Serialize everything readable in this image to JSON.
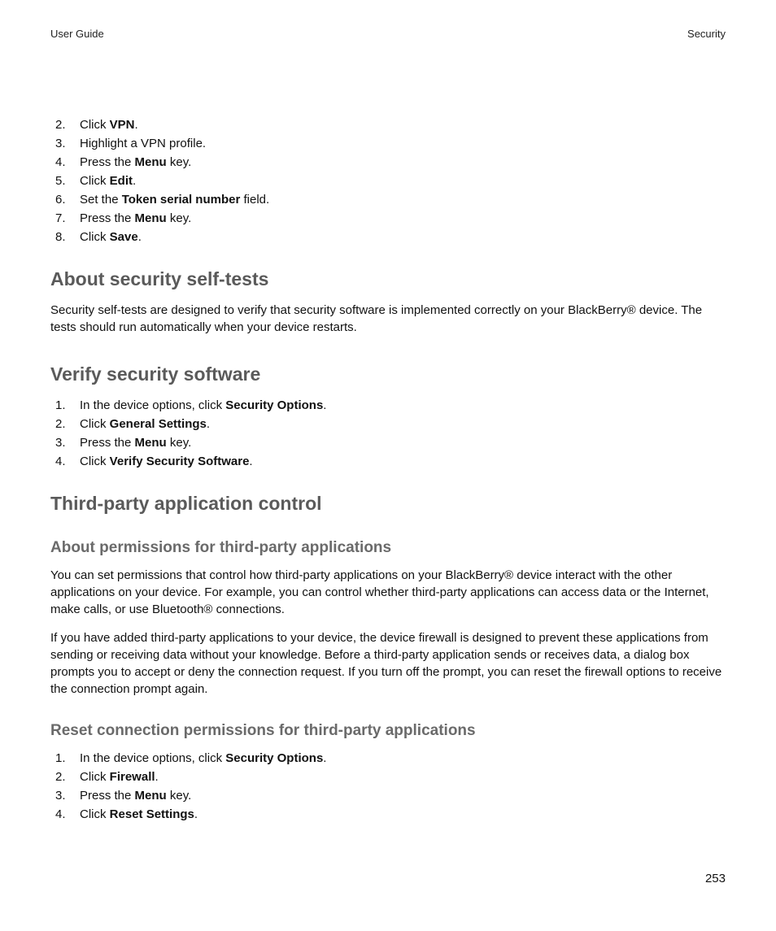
{
  "header": {
    "left": "User Guide",
    "right": "Security"
  },
  "steps_top": [
    {
      "n": "2.",
      "pre": "Click ",
      "bold": "VPN",
      "post": "."
    },
    {
      "n": "3.",
      "pre": "Highlight a VPN profile.",
      "bold": "",
      "post": ""
    },
    {
      "n": "4.",
      "pre": "Press the ",
      "bold": "Menu",
      "post": " key."
    },
    {
      "n": "5.",
      "pre": "Click ",
      "bold": "Edit",
      "post": "."
    },
    {
      "n": "6.",
      "pre": "Set the ",
      "bold": "Token serial number",
      "post": " field."
    },
    {
      "n": "7.",
      "pre": "Press the ",
      "bold": "Menu",
      "post": " key."
    },
    {
      "n": "8.",
      "pre": "Click ",
      "bold": "Save",
      "post": "."
    }
  ],
  "section_about_selftests": {
    "title": "About security self-tests",
    "body": "Security self-tests are designed to verify that security software is implemented correctly on your BlackBerry® device. The tests should run automatically when your device restarts."
  },
  "section_verify": {
    "title": "Verify security software",
    "steps": [
      {
        "n": "1.",
        "pre": "In the device options, click ",
        "bold": "Security Options",
        "post": "."
      },
      {
        "n": "2.",
        "pre": "Click ",
        "bold": "General Settings",
        "post": "."
      },
      {
        "n": "3.",
        "pre": "Press the ",
        "bold": "Menu",
        "post": " key."
      },
      {
        "n": "4.",
        "pre": "Click ",
        "bold": "Verify Security Software",
        "post": "."
      }
    ]
  },
  "section_thirdparty": {
    "title": "Third-party application control",
    "sub_about": {
      "title": "About permissions for third-party applications",
      "p1": "You can set permissions that control how third-party applications on your BlackBerry® device interact with the other applications on your device. For example, you can control whether third-party applications can access data or the Internet, make calls, or use Bluetooth® connections.",
      "p2": "If you have added third-party applications to your device, the device firewall is designed to prevent these applications from sending or receiving data without your knowledge. Before a third-party application sends or receives data, a dialog box prompts you to accept or deny the connection request. If you turn off the prompt, you can reset the firewall options to receive the connection prompt again."
    },
    "sub_reset": {
      "title": "Reset connection permissions for third-party applications",
      "steps": [
        {
          "n": "1.",
          "pre": "In the device options, click ",
          "bold": "Security Options",
          "post": "."
        },
        {
          "n": "2.",
          "pre": "Click ",
          "bold": "Firewall",
          "post": "."
        },
        {
          "n": "3.",
          "pre": "Press the ",
          "bold": "Menu",
          "post": " key."
        },
        {
          "n": "4.",
          "pre": "Click ",
          "bold": "Reset Settings",
          "post": "."
        }
      ]
    }
  },
  "page_number": "253"
}
